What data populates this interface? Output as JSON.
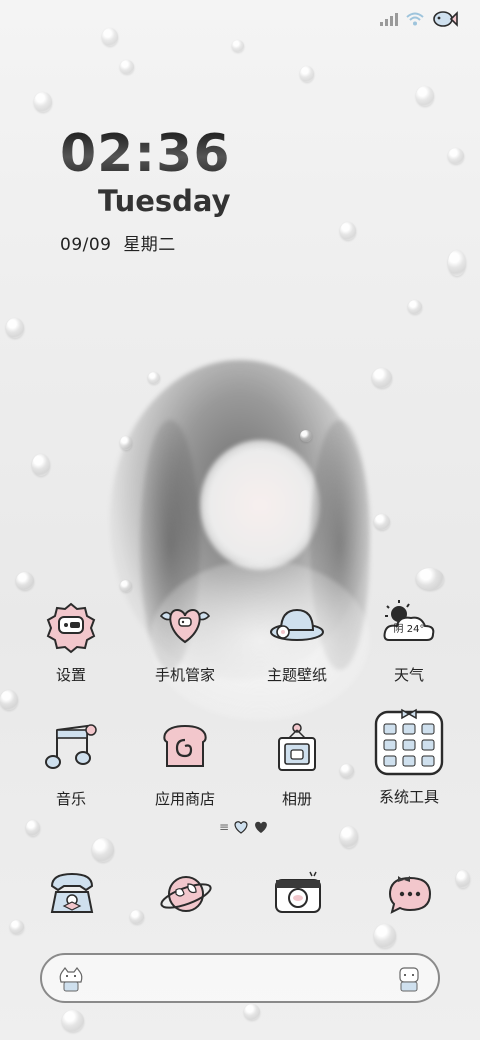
{
  "status_bar": {
    "icons": [
      "signal-icon",
      "wifi-icon",
      "fish-icon"
    ]
  },
  "clock": {
    "time": "02:36",
    "weekday": "Tuesday",
    "date": "09/09",
    "weekday_cn": "星期二"
  },
  "apps_row1": [
    {
      "label": "设置",
      "icon": "settings-icon"
    },
    {
      "label": "手机管家",
      "icon": "phone-manager-icon"
    },
    {
      "label": "主题壁纸",
      "icon": "theme-icon"
    },
    {
      "label": "天气",
      "icon": "weather-icon"
    }
  ],
  "weather_temp": "阴 24°",
  "apps_row2": [
    {
      "label": "音乐",
      "icon": "music-icon"
    },
    {
      "label": "应用商店",
      "icon": "app-store-icon"
    },
    {
      "label": "相册",
      "icon": "gallery-icon"
    },
    {
      "label": "系统工具",
      "icon": "system-tools-folder-icon"
    }
  ],
  "dock": [
    {
      "icon": "phone-icon"
    },
    {
      "icon": "browser-icon"
    },
    {
      "icon": "camera-icon"
    },
    {
      "icon": "messages-icon"
    }
  ],
  "colors": {
    "pink": "#f2c7cc",
    "blue": "#cfe0ee",
    "outline": "#2b2b2b"
  }
}
